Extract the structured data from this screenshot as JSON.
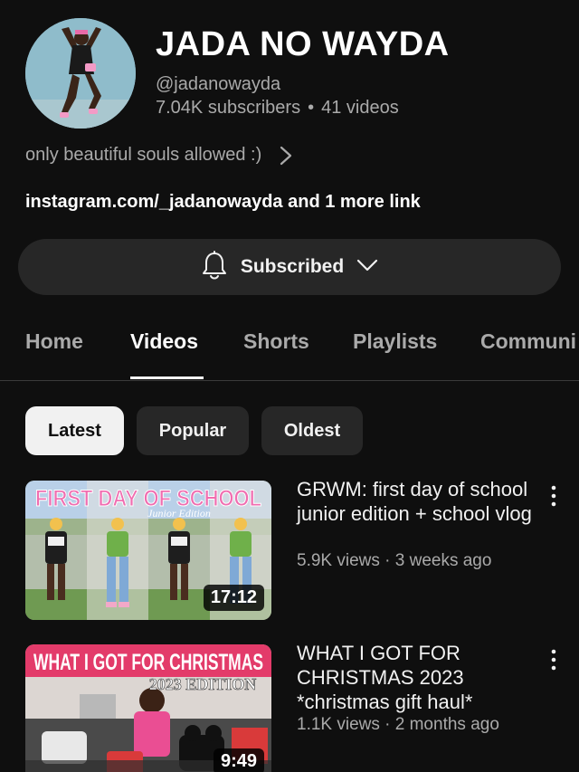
{
  "channel": {
    "name": "JADA NO WAYDA",
    "handle": "@jadanowayda",
    "subscribers": "7.04K subscribers",
    "separator": "•",
    "videos": "41 videos",
    "description": "only beautiful souls allowed :)",
    "links": "instagram.com/_jadanowayda and 1 more link",
    "subscribe_label": "Subscribed"
  },
  "tabs": [
    {
      "label": "Home"
    },
    {
      "label": "Videos",
      "active": true
    },
    {
      "label": "Shorts"
    },
    {
      "label": "Playlists"
    },
    {
      "label": "Communi"
    }
  ],
  "chips": [
    {
      "label": "Latest",
      "selected": true
    },
    {
      "label": "Popular"
    },
    {
      "label": "Oldest"
    }
  ],
  "videos": [
    {
      "thumbnail_text": "FIRST DAY OF SCHOOL",
      "thumbnail_subtext": "Junior Edition",
      "duration": "17:12",
      "title": "GRWM: first day of school junior edition + school vlog",
      "meta": "5.9K views · 3 weeks ago"
    },
    {
      "thumbnail_text": "WHAT I GOT FOR CHRISTMAS",
      "thumbnail_subtext": "2023 EDITION",
      "duration": "9:49",
      "title": "WHAT I GOT FOR CHRISTMAS 2023 *christmas gift haul*",
      "meta": "1.1K views · 2 months ago"
    }
  ],
  "icons": {
    "bell": "bell-icon",
    "chevron_down": "chevron-down-icon",
    "chevron_right": "chevron-right-icon",
    "more": "more-vert-icon"
  },
  "colors": {
    "background": "#0f0f0f",
    "surface": "#272727",
    "text_primary": "#f1f1f1",
    "text_secondary": "#aaaaaa",
    "thumb1_title": "#f06db0",
    "thumb2_banner": "#e33b6a"
  }
}
